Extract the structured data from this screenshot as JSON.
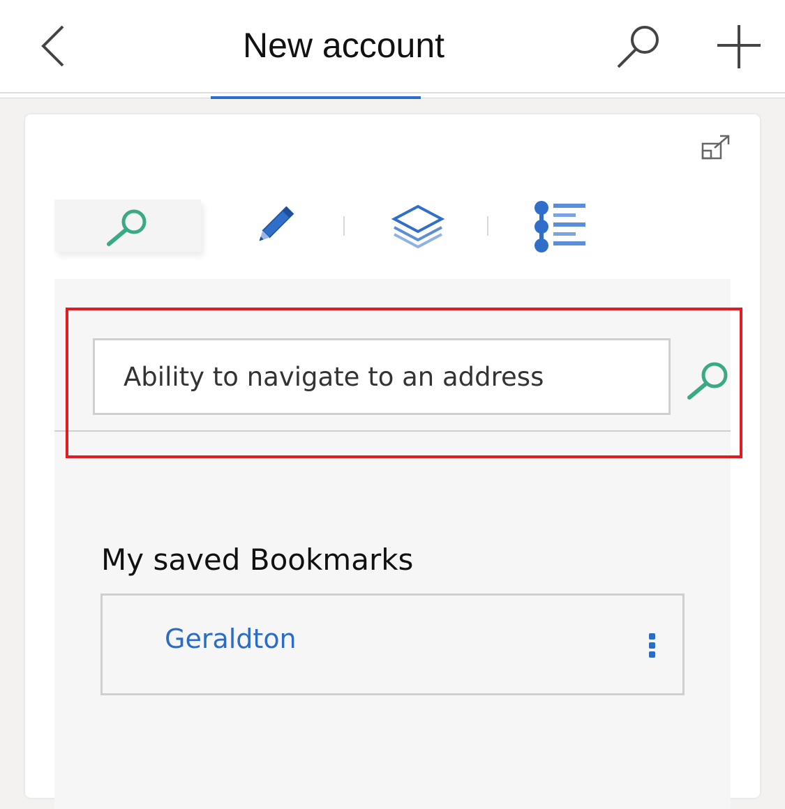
{
  "header": {
    "title": "New account",
    "icons": [
      "back-chevron-icon",
      "search-icon",
      "plus-icon"
    ],
    "accent_color": "#2b6ccd"
  },
  "card": {
    "expand_icon": "expand-icon",
    "toolbar": {
      "tools": [
        {
          "name": "search",
          "icon": "magnifier-icon",
          "active": true
        },
        {
          "name": "draw",
          "icon": "pencil-icon",
          "active": false
        },
        {
          "name": "layers",
          "icon": "layers-icon",
          "active": false
        },
        {
          "name": "legend",
          "icon": "legend-list-icon",
          "active": false
        }
      ]
    },
    "search": {
      "placeholder": "Ability to navigate to an address",
      "value": ""
    },
    "bookmarks": {
      "heading": "My saved Bookmarks",
      "items": [
        {
          "label": "Geraldton"
        }
      ]
    }
  },
  "colors": {
    "link": "#2b6cc4",
    "search_green": "#3aa985",
    "highlight_red": "#e21b23"
  }
}
